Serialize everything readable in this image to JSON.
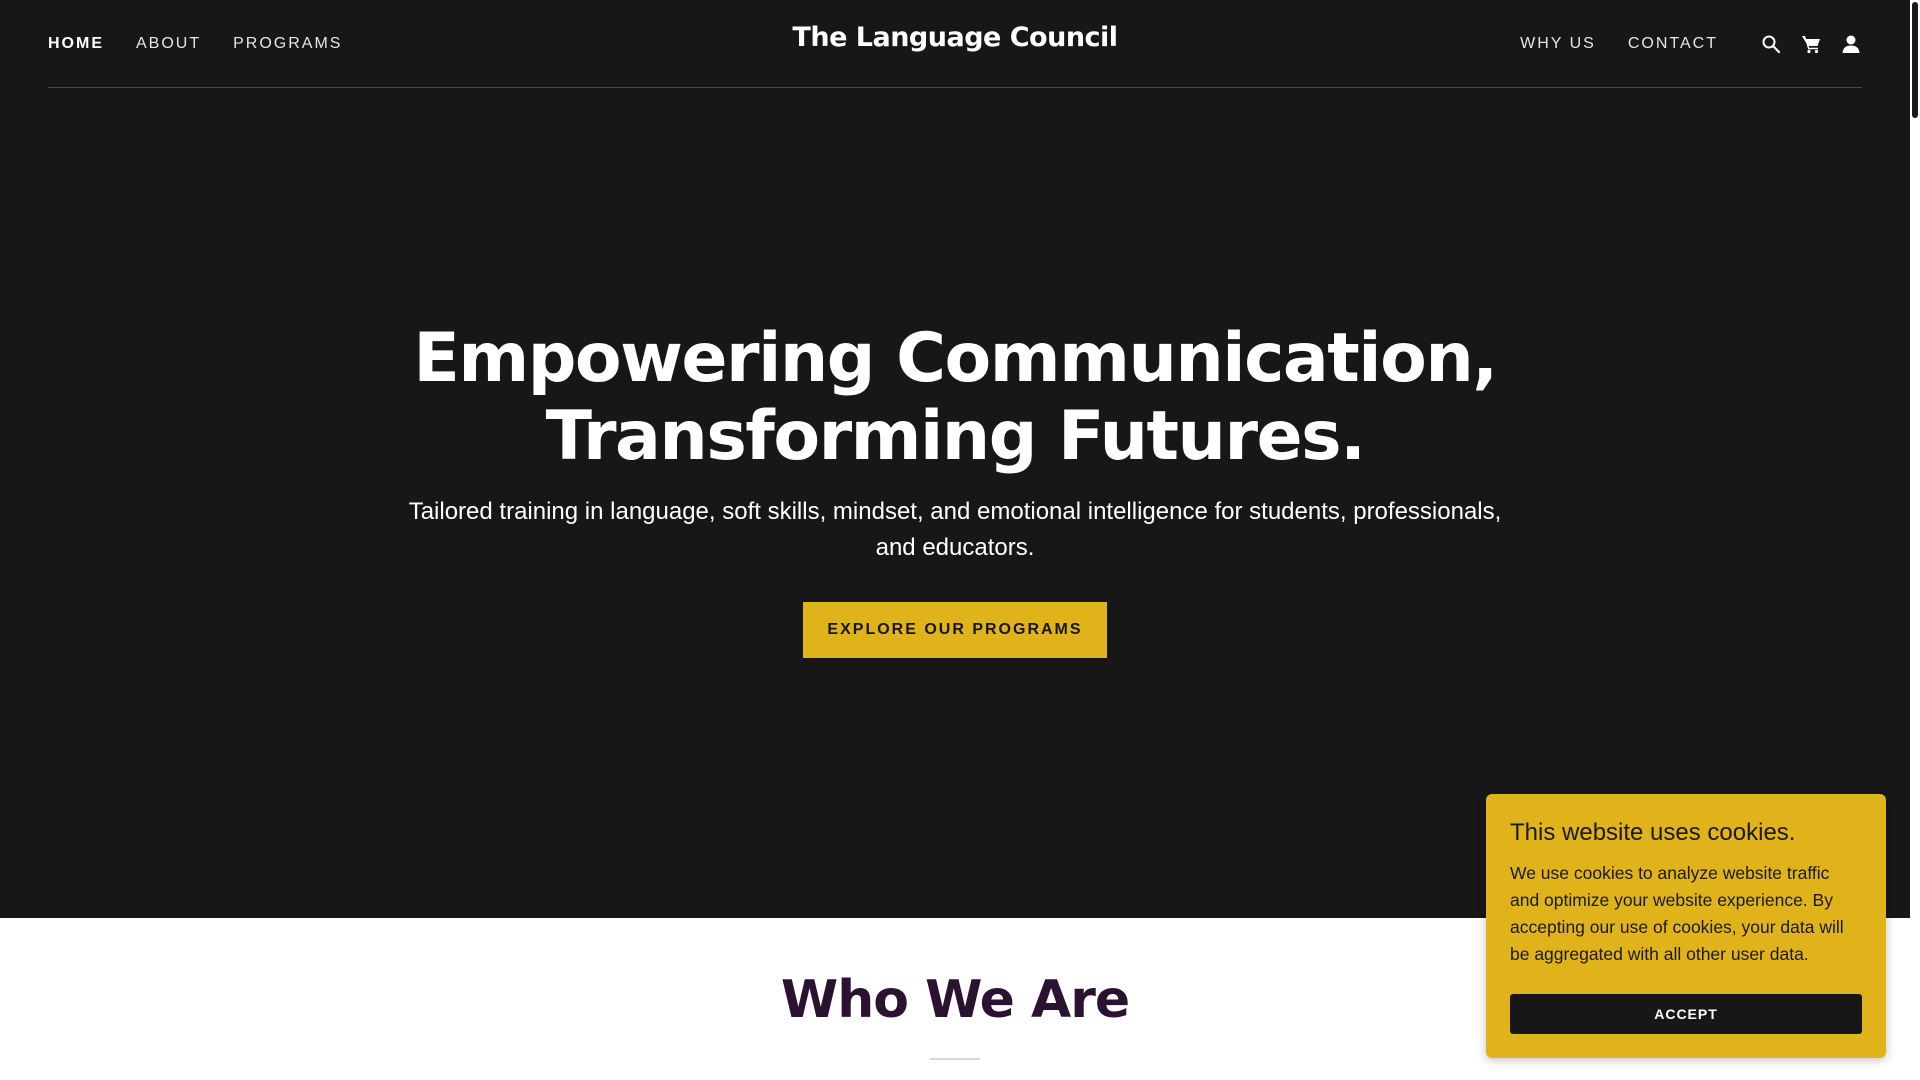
{
  "nav": {
    "brand": "The Language Council",
    "left_links": [
      "HOME",
      "ABOUT",
      "PROGRAMS"
    ],
    "right_links": [
      "WHY US",
      "CONTACT"
    ],
    "icons": [
      "search-icon",
      "cart-icon",
      "account-icon"
    ],
    "active": "HOME"
  },
  "hero": {
    "title_line1": "Empowering Communication,",
    "title_line2": "Transforming Futures.",
    "subtitle": "Tailored training in language, soft skills, mindset, and emotional intelligence for students, professionals, and educators.",
    "cta_label": "EXPLORE OUR PROGRAMS"
  },
  "section2": {
    "title": "Who We Are"
  },
  "cookie_banner": {
    "title": "This website uses cookies.",
    "body": "We use cookies to analyze website traffic and optimize your website experience. By accepting our use of cookies, your data will be aggregated with all other user data.",
    "accept_label": "ACCEPT"
  },
  "colors": {
    "hero_bg": "#171717",
    "accent": "#e0b31a",
    "heading_dark": "#2a1230"
  }
}
